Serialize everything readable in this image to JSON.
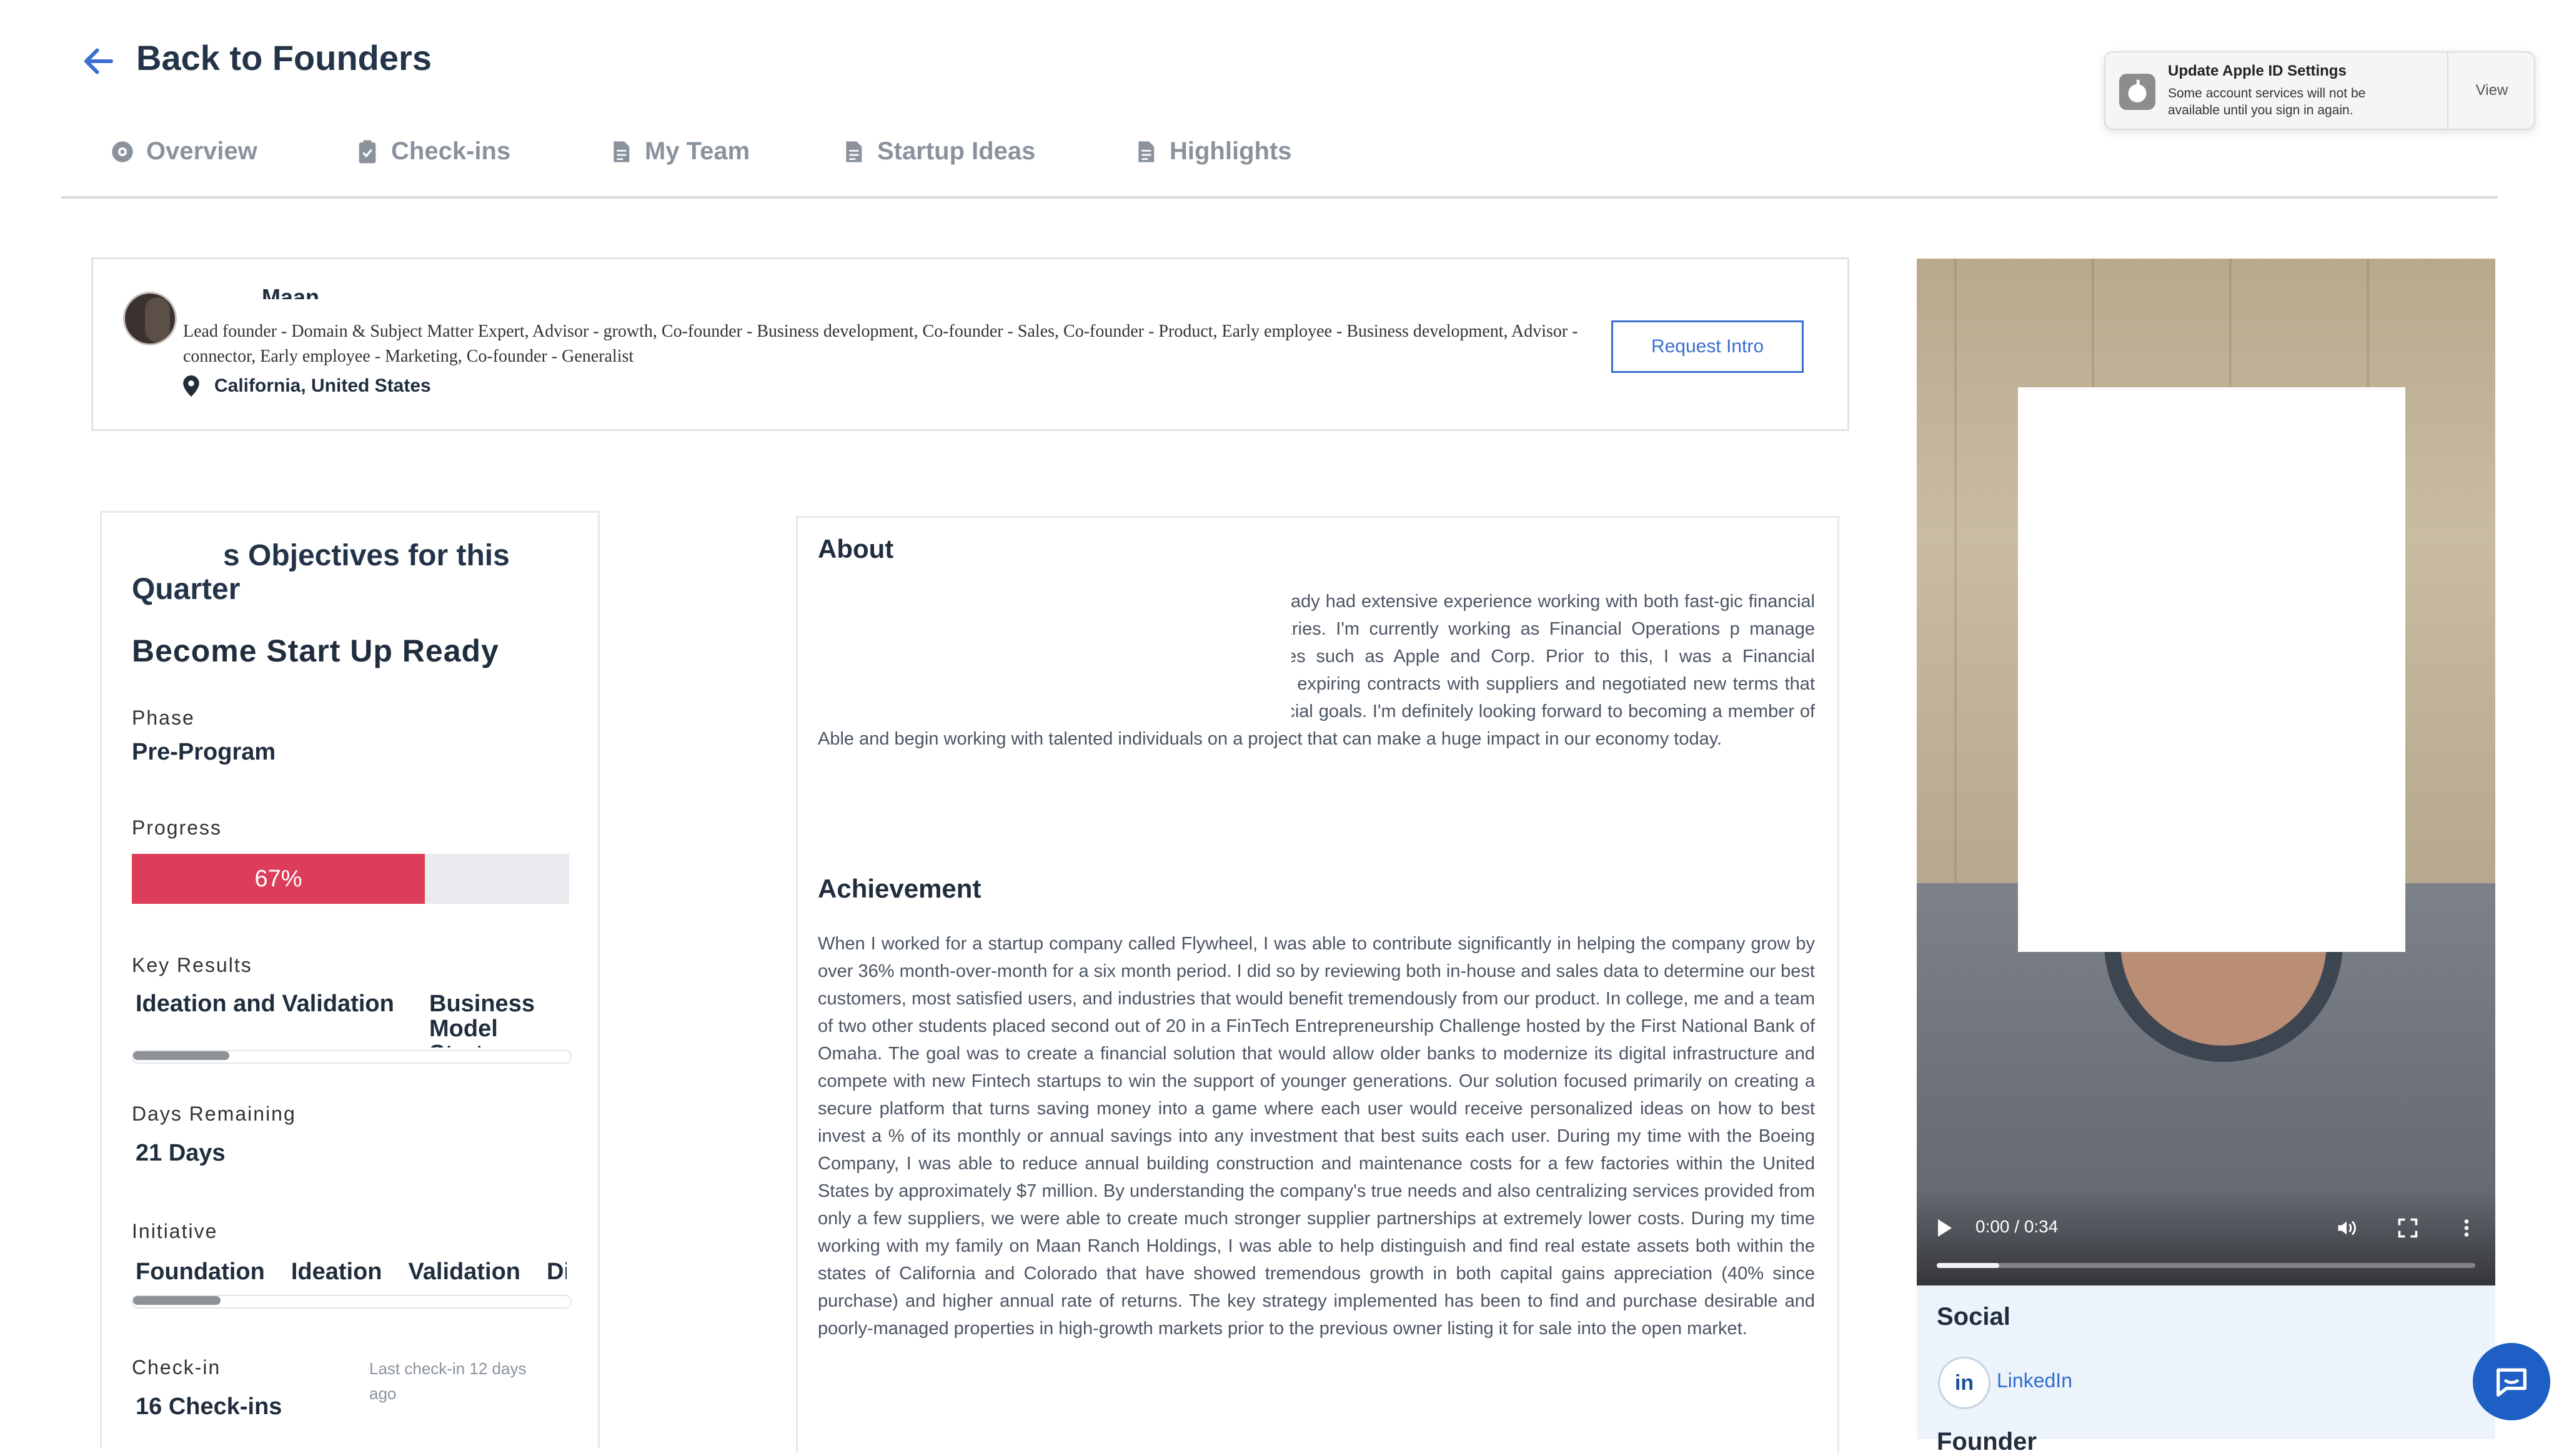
{
  "header": {
    "back_label": "Back to Founders"
  },
  "tabs": [
    {
      "label": "Overview",
      "icon": "eye-icon"
    },
    {
      "label": "Check-ins",
      "icon": "clipboard-check-icon"
    },
    {
      "label": "My Team",
      "icon": "document-icon"
    },
    {
      "label": "Startup Ideas",
      "icon": "document-icon"
    },
    {
      "label": "Highlights",
      "icon": "document-icon"
    }
  ],
  "notification": {
    "title": "Update Apple ID Settings",
    "body": "Some account services will not be available until you sign in again.",
    "action": "View"
  },
  "profile": {
    "name": "Maan",
    "roles": "Lead founder - Domain & Subject Matter Expert, Advisor - growth, Co-founder - Business development, Co-founder - Sales, Co-founder - Product, Early employee - Business development, Advisor - connector, Early employee - Marketing, Co-founder - Generalist",
    "location": "California, United States",
    "request_intro": "Request Intro"
  },
  "objectives": {
    "title": "s Objectives for this Quarter",
    "goal": "Become Start Up Ready",
    "phase_label": "Phase",
    "phase_value": "Pre-Program",
    "progress_label": "Progress",
    "progress_value": "67%",
    "progress_fraction": 0.67,
    "key_results_label": "Key Results",
    "key_results": [
      {
        "label": "Ideation and Validation"
      },
      {
        "label": "Business Model Strategy"
      }
    ],
    "key_results_progress_fraction": 0.22,
    "days_remaining_label": "Days Remaining",
    "days_remaining_value": "21 Days",
    "initiative_label": "Initiative",
    "initiatives": [
      "Foundation",
      "Ideation",
      "Validation",
      "Di"
    ],
    "initiative_progress_fraction": 0.2,
    "checkin_label": "Check-in",
    "checkin_value": "16 Check-ins",
    "checkin_note": "Last check-in 12 days ago"
  },
  "about": {
    "heading": "About",
    "text": "is looking to partake in building a better future through already had extensive experience working with both fast-gic financial roles to help companies both cut unnecessary e industries. I'm currently working as Financial Operations p manage contingent workforces for large accounts with companies such as Apple and Corp. Prior to this, I was a Financial Procurement Analyst with Boeing, where I reviewed many expiring contracts with suppliers and negotiated new terms that better resonated with the company's operational and financial goals. I'm definitely looking forward to becoming a member of Able and begin working with talented individuals on a project that can make a huge impact in our economy today.",
    "achievement_heading": "Achievement",
    "achievement_text": "When I worked for a startup company called Flywheel, I was able to contribute significantly in helping the company grow by over 36% month-over-month for a six month period. I did so by reviewing both in-house and sales data to determine our best customers, most satisfied users, and industries that would benefit tremendously from our product. In college, me and a team of two other students placed second out of 20 in a FinTech Entrepreneurship Challenge hosted by the First National Bank of Omaha. The goal was to create a financial solution that would allow older banks to modernize its digital infrastructure and compete with new Fintech startups to win the support of younger generations. Our solution focused primarily on creating a secure platform that turns saving money into a game where each user would receive personalized ideas on how to best invest a % of its monthly or annual savings into any investment that best suits each user. During my time with the Boeing Company, I was able to reduce annual building construction and maintenance costs for a few factories within the United States by approximately $7 million. By understanding the company's true needs and also centralizing services provided from only a few suppliers, we were able to create much stronger supplier partnerships at extremely lower costs. During my time working with my family on Maan Ranch Holdings, I was able to help distinguish and find real estate assets both within the states of California and Colorado that have showed tremendous growth in both capital gains appreciation (40% since purchase) and higher annual rate of returns. The key strategy implemented has been to find and purchase desirable and poorly-managed properties in high-growth markets prior to the previous owner listing it for sale into the open market."
  },
  "video": {
    "time": "0:00 / 0:34",
    "played_fraction": 0.0
  },
  "social": {
    "heading": "Social",
    "linkedin_label": "LinkedIn",
    "next_heading": "Founder"
  },
  "colors": {
    "accent": "#3b6fd0",
    "progress": "#dc3d5a",
    "chat": "#1d5fc4"
  }
}
